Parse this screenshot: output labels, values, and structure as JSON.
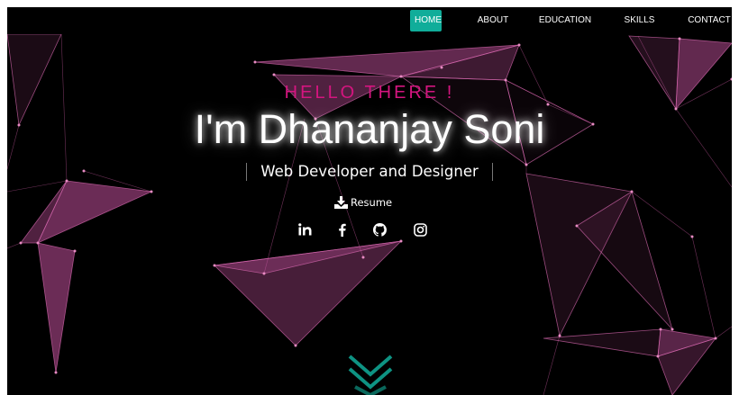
{
  "nav": {
    "items": [
      {
        "label": "HOME",
        "active": true
      },
      {
        "label": "ABOUT",
        "active": false
      },
      {
        "label": "EDUCATION",
        "active": false
      },
      {
        "label": "SKILLS",
        "active": false
      },
      {
        "label": "CONTACT",
        "active": false
      }
    ]
  },
  "hero": {
    "greeting": "HELLO THERE !",
    "name": "I'm Dhananjay Soni",
    "subtitle": "Web Developer and Designer",
    "resume_label": "Resume"
  },
  "socials": [
    {
      "name": "linkedin-icon",
      "glyph": "in"
    },
    {
      "name": "facebook-icon",
      "glyph": "f"
    },
    {
      "name": "github-icon",
      "glyph": "github"
    },
    {
      "name": "instagram-icon",
      "glyph": "instagram"
    }
  ],
  "icons": {
    "resume": "download-icon",
    "scroll": "chevron-double-down-icon"
  },
  "colors": {
    "background": "#000000",
    "accent_teal": "#10ad9a",
    "greeting_pink": "#d4157f",
    "network_pink": "#c85aa0",
    "text": "#ffffff"
  }
}
